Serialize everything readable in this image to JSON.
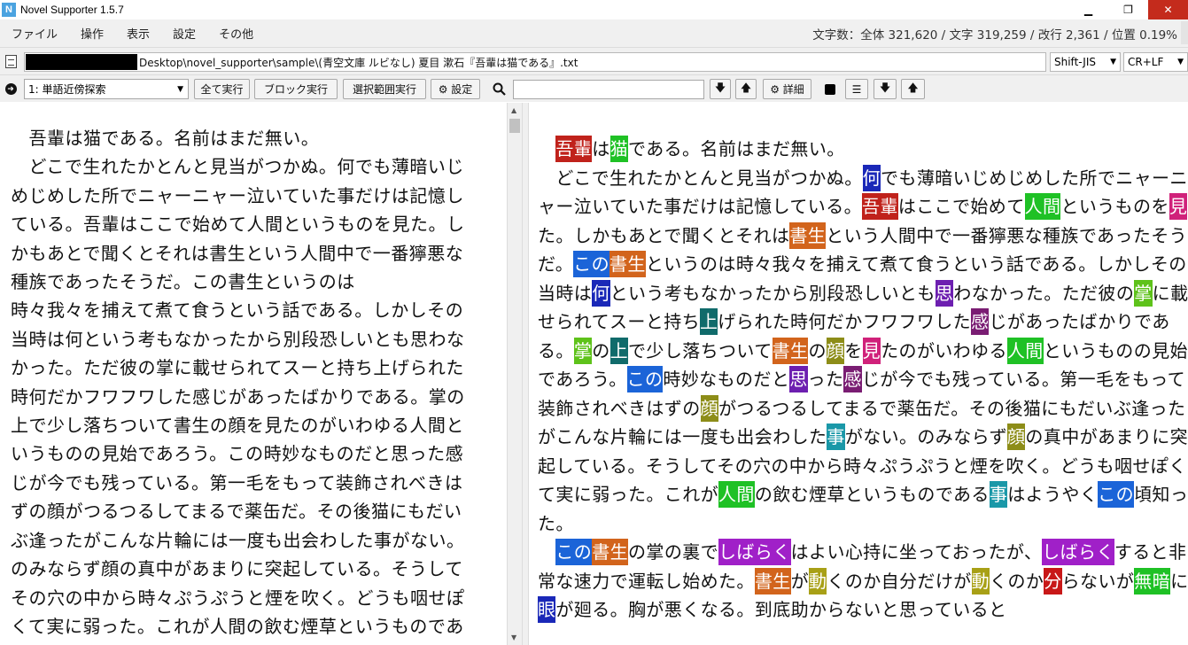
{
  "window": {
    "app_icon": "N",
    "title": "Novel Supporter 1.5.7",
    "minimize_glyph": "▁",
    "maximize_glyph": "❐",
    "close_glyph": "✕"
  },
  "menu": {
    "items": [
      "ファイル",
      "操作",
      "表示",
      "設定",
      "その他"
    ],
    "stats": "文字数：全体 321,620 / 文字 319,259 / 改行 2,361 / 位置 0.19%"
  },
  "file": {
    "path": "Desktop\\novel_supporter\\sample\\(青空文庫 ルビなし) 夏目 漱石『吾輩は猫である』.txt",
    "encoding": "Shift-JIS",
    "newline": "CR+LF"
  },
  "toolbar": {
    "mode": "1: 単語近傍探索",
    "run_all": "全て実行",
    "run_block": "ブロック実行",
    "run_selection": "選択範囲実行",
    "settings": "⚙ 設定",
    "detail": "⚙ 詳細",
    "search_value": "",
    "arrow_down": "🡇",
    "arrow_up": "🡅",
    "list_glyph": "☰",
    "chevron": "▼"
  },
  "editor": {
    "left_text": "　吾輩は猫である。名前はまだ無い。\n　どこで生れたかとんと見当がつかぬ。何でも薄暗いじめじめした所でニャーニャー泣いていた事だけは記憶している。吾輩はここで始めて人間というものを見た。しかもあとで聞くとそれは書生という人間中で一番獰悪な種族であったそうだ。この書生というのは\n時々我々を捕えて煮て食うという話である。しかしその当時は何という考もなかったから別段恐しいとも思わなかった。ただ彼の掌に載せられてスーと持ち上げられた時何だかフワフワした感じがあったばかりである。掌の上で少し落ちついて書生の顔を見たのがいわゆる人間というものの見始であろう。この時妙なものだと思った感じが今でも残っている。第一毛をもって装飾されべきはずの顔がつるつるしてまるで薬缶だ。その後猫にもだいぶ逢ったがこんな片輪には一度も出会わした事がない。のみならず顔の真中があまりに突起している。そうしてその穴の中から時々ぷうぷうと煙を吹く。どうも咽せぽくて実に弱った。これが人間の飲む煙草というものである事はようやくこの頃知った。",
    "right_segments": [
      {
        "t": "　"
      },
      {
        "t": "吾輩",
        "c": "#c0221b"
      },
      {
        "t": "は"
      },
      {
        "t": "猫",
        "c": "#1fc125"
      },
      {
        "t": "である。名前はまだ無い。\n　どこで生れたかとんと見当がつかぬ。"
      },
      {
        "t": "何",
        "c": "#1a28b8"
      },
      {
        "t": "でも薄暗いじめじめした所でニャーニャー泣いていた事だけは記憶している。"
      },
      {
        "t": "吾輩",
        "c": "#c0221b"
      },
      {
        "t": "はここで始めて"
      },
      {
        "t": "人間",
        "c": "#1fc125"
      },
      {
        "t": "というものを"
      },
      {
        "t": "見",
        "c": "#d0217a"
      },
      {
        "t": "た。しかもあとで聞くとそれは"
      },
      {
        "t": "書生",
        "c": "#d2641c"
      },
      {
        "t": "という人間中で一番獰悪な種族であったそうだ。"
      },
      {
        "t": "この",
        "c": "#1b64d8"
      },
      {
        "t": "書生",
        "c": "#d2641c"
      },
      {
        "t": "というのは時々我々を捕えて煮て食うという話である。しかしその当時は"
      },
      {
        "t": "何",
        "c": "#1a28b8"
      },
      {
        "t": "という考もなかったから別段恐しいとも"
      },
      {
        "t": "思",
        "c": "#6d1fb0"
      },
      {
        "t": "わなかった。ただ彼の"
      },
      {
        "t": "掌",
        "c": "#5ec21a"
      },
      {
        "t": "に載せられてスーと持ち"
      },
      {
        "t": "上",
        "c": "#106b6b"
      },
      {
        "t": "げられた時何だかフワフワした"
      },
      {
        "t": "感",
        "c": "#7a1d73"
      },
      {
        "t": "じがあったばかりである。"
      },
      {
        "t": "掌",
        "c": "#5ec21a"
      },
      {
        "t": "の"
      },
      {
        "t": "上",
        "c": "#106b6b"
      },
      {
        "t": "で少し落ちついて"
      },
      {
        "t": "書生",
        "c": "#d2641c"
      },
      {
        "t": "の"
      },
      {
        "t": "顔",
        "c": "#8d8d18"
      },
      {
        "t": "を"
      },
      {
        "t": "見",
        "c": "#d0217a"
      },
      {
        "t": "たのがいわゆる"
      },
      {
        "t": "人間",
        "c": "#1fc125"
      },
      {
        "t": "というものの見始であろう。"
      },
      {
        "t": "この",
        "c": "#1b64d8"
      },
      {
        "t": "時妙なものだと"
      },
      {
        "t": "思",
        "c": "#6d1fb0"
      },
      {
        "t": "った"
      },
      {
        "t": "感",
        "c": "#7a1d73"
      },
      {
        "t": "じが今でも残っている。第一毛をもって装飾されべきはずの"
      },
      {
        "t": "顔",
        "c": "#8d8d18"
      },
      {
        "t": "がつるつるしてまるで薬缶だ。その後猫にもだいぶ逢ったがこんな片輪には一度も出会わした"
      },
      {
        "t": "事",
        "c": "#1a98a8"
      },
      {
        "t": "がない。のみならず"
      },
      {
        "t": "顔",
        "c": "#8d8d18"
      },
      {
        "t": "の真中があまりに突起している。そうしてその穴の中から時々ぷうぷうと煙を吹く。どうも咽せぽくて実に弱った。これが"
      },
      {
        "t": "人間",
        "c": "#1fc125"
      },
      {
        "t": "の飲む煙草というものである"
      },
      {
        "t": "事",
        "c": "#1a98a8"
      },
      {
        "t": "はようやく"
      },
      {
        "t": "この",
        "c": "#1b64d8"
      },
      {
        "t": "頃知った。\n　"
      },
      {
        "t": "この",
        "c": "#1b64d8"
      },
      {
        "t": "書生",
        "c": "#d2641c"
      },
      {
        "t": "の掌の裏で"
      },
      {
        "t": "しばらく",
        "c": "#a020c8"
      },
      {
        "t": "はよい心持に坐っておったが、"
      },
      {
        "t": "しばらく",
        "c": "#a020c8"
      },
      {
        "t": "すると非常な速力で運転し始めた。"
      },
      {
        "t": "書生",
        "c": "#d2641c"
      },
      {
        "t": "が"
      },
      {
        "t": "動",
        "c": "#a8a016"
      },
      {
        "t": "くのか自分だけが"
      },
      {
        "t": "動",
        "c": "#a8a016"
      },
      {
        "t": "くのか"
      },
      {
        "t": "分",
        "c": "#c81818"
      },
      {
        "t": "らないが"
      },
      {
        "t": "無暗",
        "c": "#1fc125"
      },
      {
        "t": "に"
      },
      {
        "t": "眼",
        "c": "#1a28b8"
      },
      {
        "t": "が廻る。胸が悪くなる。到底助からないと思っていると"
      }
    ]
  }
}
